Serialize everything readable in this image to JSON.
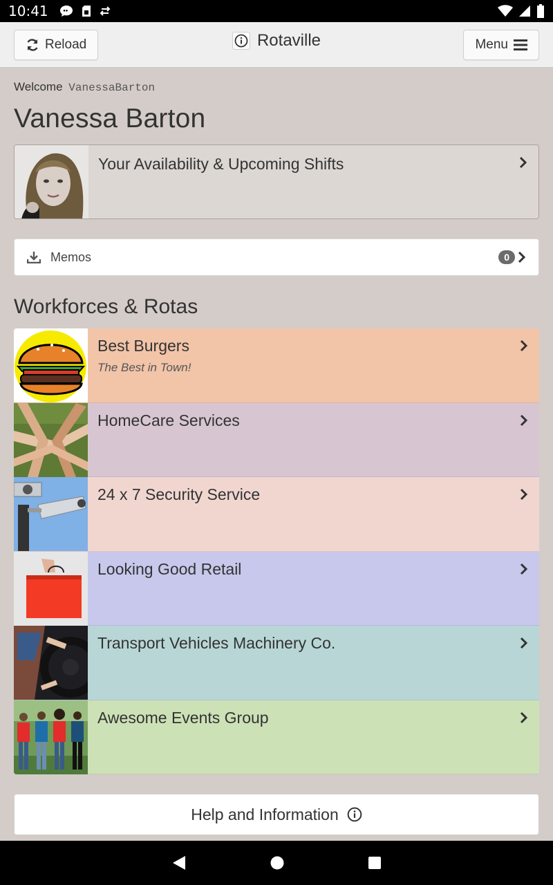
{
  "status_bar": {
    "time": "10:41",
    "left_icons": [
      "chat-icon",
      "sim-card-icon",
      "sync-icon"
    ],
    "right_icons": [
      "wifi-icon",
      "signal-icon",
      "battery-icon"
    ]
  },
  "header": {
    "reload_label": "Reload",
    "app_title": "Rotaville",
    "menu_label": "Menu"
  },
  "user": {
    "welcome_label": "Welcome",
    "username": "VanessaBarton",
    "full_name": "Vanessa Barton",
    "availability_label": "Your Availability & Upcoming Shifts"
  },
  "memos": {
    "label": "Memos",
    "count": "0"
  },
  "workforces": {
    "section_title": "Workforces & Rotas",
    "items": [
      {
        "name": "Best Burgers",
        "subtitle": "The Best in Town!",
        "bg": "#f2c4a8"
      },
      {
        "name": "HomeCare Services",
        "subtitle": "",
        "bg": "#d7c6d2"
      },
      {
        "name": "24 x 7 Security Service",
        "subtitle": "",
        "bg": "#f1d6d0"
      },
      {
        "name": "Looking Good Retail",
        "subtitle": "",
        "bg": "#c7c8ec"
      },
      {
        "name": "Transport Vehicles Machinery Co.",
        "subtitle": "",
        "bg": "#b8d6d6"
      },
      {
        "name": "Awesome Events Group",
        "subtitle": "",
        "bg": "#cde1b6"
      }
    ]
  },
  "help": {
    "label": "Help and Information"
  },
  "colors": {
    "page_bg": "#d4ccc8",
    "header_bg": "#efefef"
  }
}
